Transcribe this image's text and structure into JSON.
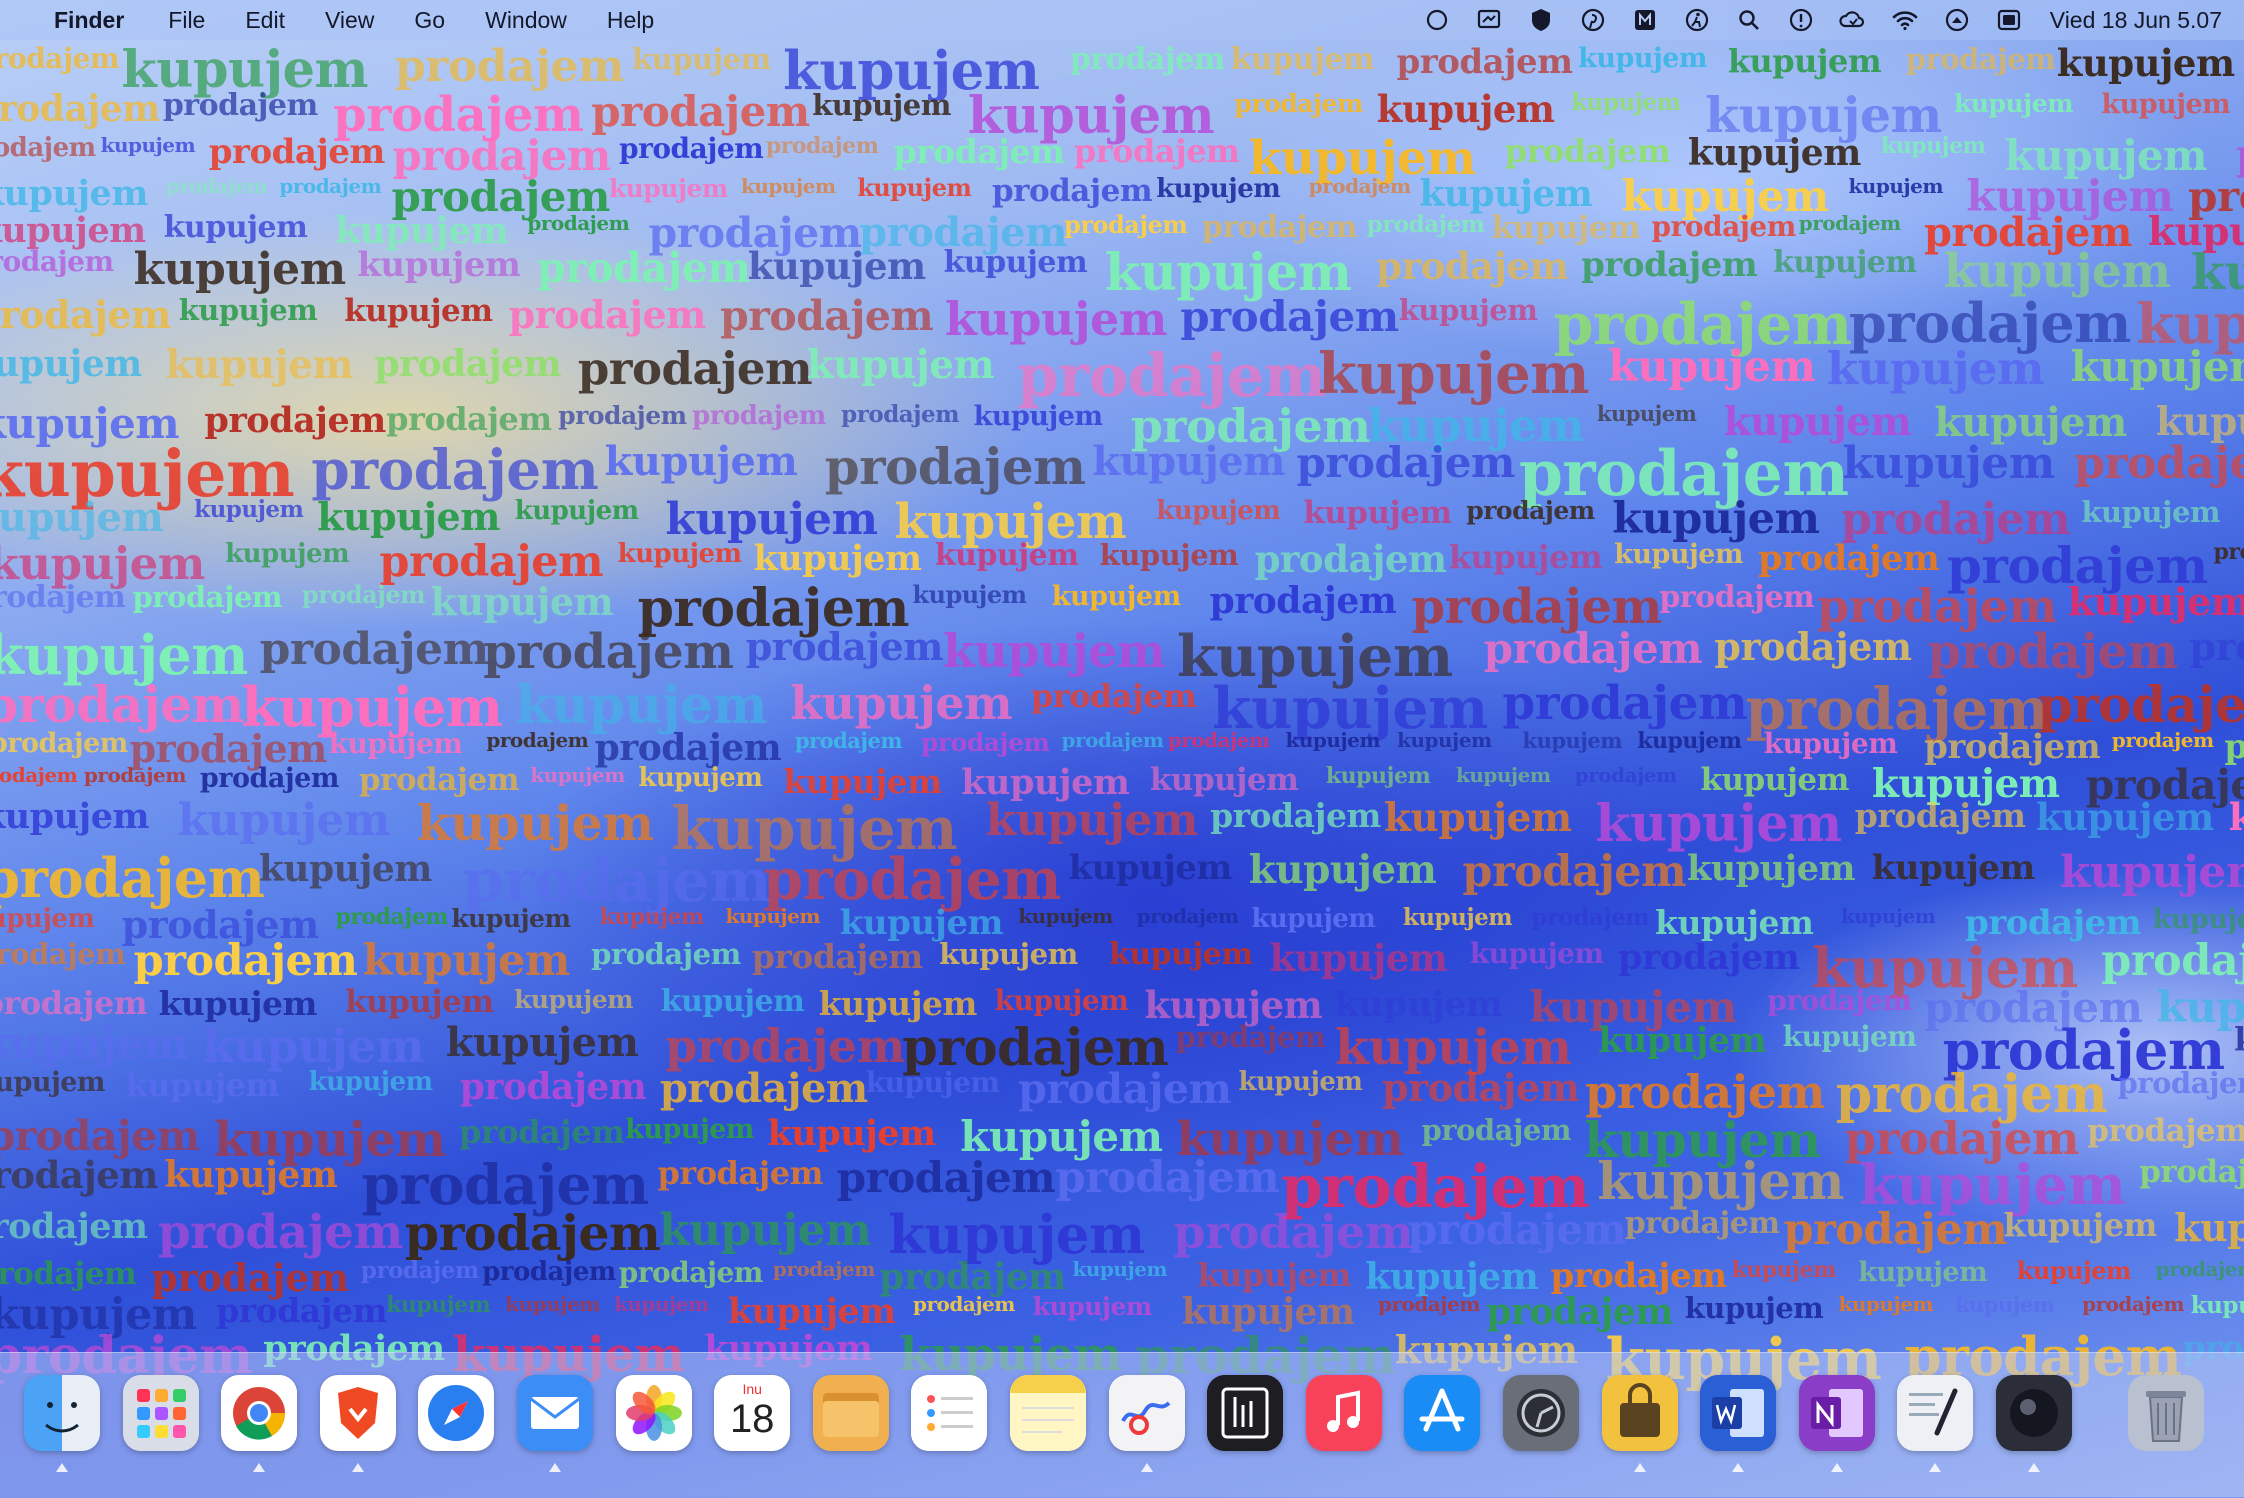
{
  "menubar": {
    "app_name": "Finder",
    "menus": [
      "File",
      "Edit",
      "View",
      "Go",
      "Window",
      "Help"
    ],
    "status_icons": [
      "record-icon",
      "display-icon",
      "shield-icon",
      "pinterest-icon",
      "pdf-icon",
      "accessibility-icon",
      "search-icon",
      "info-icon",
      "cloud-sync-icon",
      "wifi-icon",
      "screen-mirror-icon",
      "control-center-icon"
    ],
    "clock": "Vied 18 Jun  5.07"
  },
  "wallpaper": {
    "words": [
      "prodajem",
      "kupujem"
    ]
  },
  "dock": {
    "apps": [
      {
        "name": "finder-icon",
        "color": "#4ca3f5",
        "indicator": true
      },
      {
        "name": "launchpad-icon",
        "color": "#d9dde8",
        "indicator": false
      },
      {
        "name": "chrome-icon",
        "color": "#ffffff",
        "indicator": true
      },
      {
        "name": "brave-icon",
        "color": "#f04a24",
        "indicator": true
      },
      {
        "name": "safari-icon",
        "color": "#2a7ff0",
        "indicator": false
      },
      {
        "name": "mail-icon",
        "color": "#3c8ef6",
        "indicator": true
      },
      {
        "name": "photos-icon",
        "color": "#ffffff",
        "indicator": false
      },
      {
        "name": "calendar-icon",
        "color": "#ffffff",
        "indicator": false,
        "month": "Inu",
        "day": "18"
      },
      {
        "name": "notes-folder-icon",
        "color": "#f0b050",
        "indicator": false
      },
      {
        "name": "reminders-icon",
        "color": "#ffffff",
        "indicator": false
      },
      {
        "name": "notes-icon",
        "color": "#fff6c4",
        "indicator": false
      },
      {
        "name": "freeform-icon",
        "color": "#f3f3f6",
        "indicator": true
      },
      {
        "name": "stocks-icon",
        "color": "#1d1d22",
        "indicator": false
      },
      {
        "name": "music-icon",
        "color": "#f8425a",
        "indicator": false
      },
      {
        "name": "app-store-icon",
        "color": "#1a8cf5",
        "indicator": false
      },
      {
        "name": "system-settings-icon",
        "color": "#6a6e78",
        "indicator": false
      },
      {
        "name": "archive-utility-icon",
        "color": "#f2c13d",
        "indicator": true
      },
      {
        "name": "word-icon",
        "color": "#2b5fd6",
        "indicator": true
      },
      {
        "name": "onenote-icon",
        "color": "#8a3ec8",
        "indicator": true
      },
      {
        "name": "script-editor-icon",
        "color": "#eef0f5",
        "indicator": true
      },
      {
        "name": "terminal-icon",
        "color": "#2b2e38",
        "indicator": true
      },
      {
        "name": "trash-icon",
        "color": "#b9c0cf",
        "indicator": false
      }
    ]
  }
}
